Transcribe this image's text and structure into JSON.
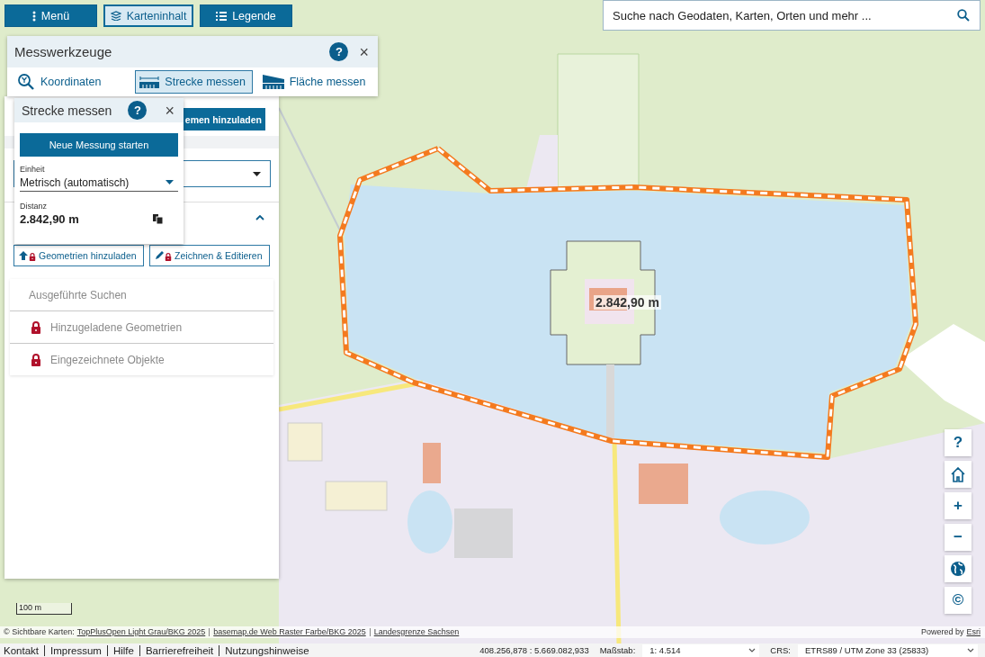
{
  "toolbar": {
    "buttons": [
      {
        "label": "Menü",
        "selected": false
      },
      {
        "label": "Karteninhalt",
        "selected": true
      },
      {
        "label": "Legende",
        "selected": false
      }
    ]
  },
  "search": {
    "placeholder": "Suche nach Geodaten, Karten, Orten und mehr ..."
  },
  "measure_tools": {
    "title": "Messwerkzeuge",
    "help": "?",
    "close": "×",
    "tabs": [
      {
        "label": "Koordinaten",
        "selected": false
      },
      {
        "label": "Strecke messen",
        "selected": true
      },
      {
        "label": "Fläche messen",
        "selected": false
      }
    ]
  },
  "side_panel": {
    "top_button": "emen hinzuladen",
    "section_expanded": true,
    "buttons": [
      {
        "label": "Geometrien hinzuladen",
        "locked": true
      },
      {
        "label": "Zeichnen & Editieren",
        "locked": true
      }
    ],
    "list": [
      {
        "label": "Ausgeführte Suchen",
        "locked": false
      },
      {
        "label": "Hinzugeladene Geometrien",
        "locked": true
      },
      {
        "label": "Eingezeichnete Objekte",
        "locked": true
      }
    ]
  },
  "distance_panel": {
    "title": "Strecke messen",
    "help": "?",
    "close": "×",
    "start_button": "Neue Messung starten",
    "unit_label": "Einheit",
    "unit_value": "Metrisch (automatisch)",
    "distance_label": "Distanz",
    "distance_value": "2.842,90 m"
  },
  "map": {
    "measurement_label": "2.842,90 m",
    "scale_bar": "100 m",
    "controls": [
      {
        "kind": "text",
        "label": "?"
      },
      {
        "kind": "home"
      },
      {
        "kind": "text",
        "label": "+"
      },
      {
        "kind": "text",
        "label": "−"
      },
      {
        "kind": "globe"
      },
      {
        "kind": "text",
        "label": "©"
      }
    ]
  },
  "attribution": {
    "prefix": "© Sichtbare Karten:",
    "links": [
      "TopPlusOpen Light Grau/BKG 2025",
      "basemap.de Web Raster Farbe/BKG 2025",
      "Landesgrenze Sachsen"
    ],
    "powered_by": "Powered by",
    "esri": "Esri"
  },
  "footer": {
    "links": [
      "Kontakt",
      "Impressum",
      "Hilfe",
      "Barrierefreiheit",
      "Nutzungshinweise"
    ],
    "coordinates": "408.256,878 : 5.669.082,933",
    "scale_label": "Maßstab:",
    "scale_value": "1: 4.514",
    "crs_label": "CRS:",
    "crs_value": "ETRS89 / UTM Zone 33 (25833)"
  }
}
